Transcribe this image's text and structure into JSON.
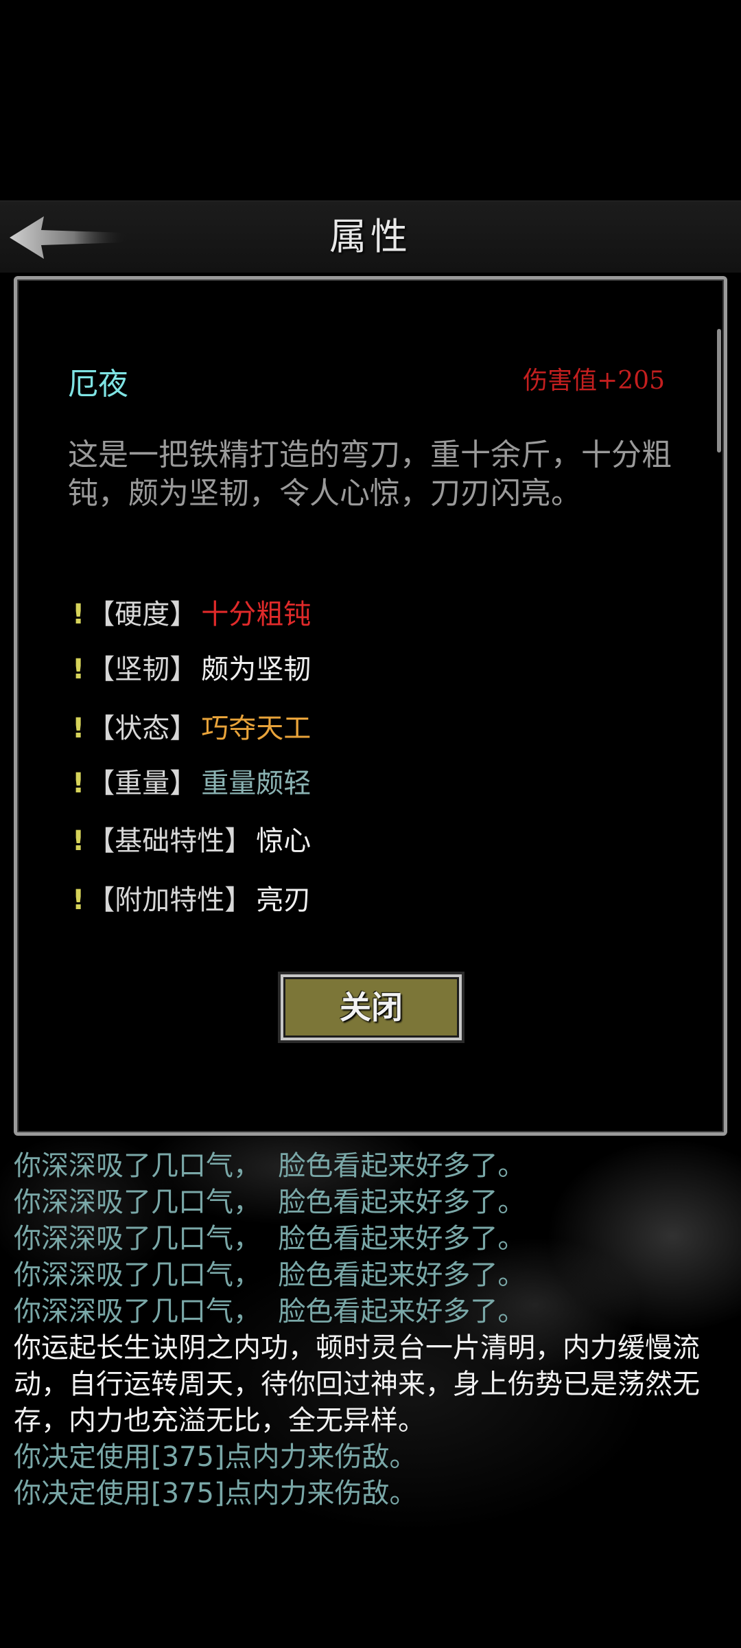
{
  "header": {
    "title": "属性",
    "back_icon": "back-arrow-icon"
  },
  "dialog": {
    "item_name": "厄夜",
    "damage": "伤害值+205",
    "description": "这是一把铁精打造的弯刀，重十余斤，十分粗钝，颇为坚韧，令人心惊，刀刃闪亮。",
    "attributes": [
      {
        "marker": "!",
        "label": "【硬度】",
        "value": "十分粗钝",
        "color": "#e02a2a"
      },
      {
        "marker": "!",
        "label": "【坚韧】",
        "value": "颇为坚韧",
        "color": "#f0f0f0"
      },
      {
        "marker": "!",
        "label": "【状态】",
        "value": "巧夺天工",
        "color": "#e8a33a"
      },
      {
        "marker": "!",
        "label": "【重量】",
        "value": "重量颇轻",
        "color": "#8bb3b3"
      },
      {
        "marker": "!",
        "label": "【基础特性】",
        "value": "惊心",
        "color": "#f0f0f0"
      },
      {
        "marker": "!",
        "label": "【附加特性】",
        "value": "亮刃",
        "color": "#f0f0f0"
      }
    ],
    "close_label": "关闭"
  },
  "log": [
    {
      "text": "你深深吸了几口气，  脸色看起来好多了。",
      "color": "teal"
    },
    {
      "text": "你深深吸了几口气，  脸色看起来好多了。",
      "color": "teal"
    },
    {
      "text": "你深深吸了几口气，  脸色看起来好多了。",
      "color": "teal"
    },
    {
      "text": "你深深吸了几口气，  脸色看起来好多了。",
      "color": "teal"
    },
    {
      "text": "你深深吸了几口气，  脸色看起来好多了。",
      "color": "teal"
    },
    {
      "text": "你运起长生诀阴之内功，顿时灵台一片清明，内力缓慢流动，自行运转周天，待你回过神来，身上伤势已是荡然无存，内力也充溢无比，全无异样。",
      "color": "white"
    },
    {
      "text": "你决定使用[375]点内力来伤敌。",
      "color": "teal"
    },
    {
      "text": "你决定使用[375]点内力来伤敌。",
      "color": "teal"
    }
  ]
}
